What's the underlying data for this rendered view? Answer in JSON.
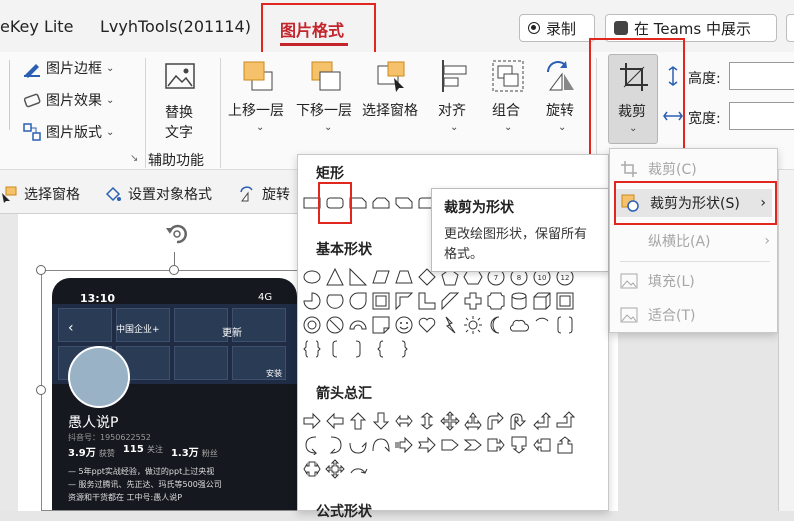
{
  "tabs": [
    {
      "label": "eKey Lite"
    },
    {
      "label": "LvyhTools(201114)"
    },
    {
      "label": "图片格式"
    }
  ],
  "header_buttons": {
    "record": "录制",
    "teams": "在 Teams 中展示"
  },
  "ribbon": {
    "picture_border": "图片边框",
    "picture_effects": "图片效果",
    "picture_layout": "图片版式",
    "alt_text_line1": "替换",
    "alt_text_line2": "文字",
    "accessibility_group": "辅助功能",
    "bring_forward": "上移一层",
    "send_backward": "下移一层",
    "selection_pane": "选择窗格",
    "align": "对齐",
    "group": "组合",
    "rotate": "旋转",
    "crop": "裁剪",
    "height": "高度:",
    "width": "宽度:"
  },
  "toolbar2": {
    "selection_pane": "选择窗格",
    "format_object": "设置对象格式",
    "rotate": "旋转"
  },
  "shapes_menu": {
    "rectangles": "矩形",
    "basic_shapes": "基本形状",
    "block_arrows": "箭头总汇",
    "equation_shapes": "公式形状"
  },
  "tooltip": {
    "title": "裁剪为形状",
    "description": "更改绘图形状，保留所有格式。"
  },
  "crop_menu": {
    "crop": "裁剪(C)",
    "crop_to_shape": "裁剪为形状(S)",
    "aspect_ratio": "纵横比(A)",
    "fill": "填充(L)",
    "fit": "适合(T)"
  },
  "phone": {
    "time": "13:10",
    "signal": "4G",
    "update_label": "更新",
    "profile_name": "愚人说P",
    "douyin_id": "抖音号：1950622552",
    "stats": [
      {
        "value": "3.9万",
        "label": "获赞"
      },
      {
        "value": "115",
        "label": "关注"
      },
      {
        "value": "1.3万",
        "label": "粉丝"
      }
    ],
    "bio_line1": "— 5年ppt实战经验，做过的ppt上过央视",
    "bio_line2": "— 服务过腾讯、先正达、玛氏等500强公司",
    "bio_line3": "资源和干货都在 工中号:愚人说P",
    "banner_caption": "中国企业+",
    "install_label": "安装"
  },
  "colors": {
    "accent_red": "#c4242b",
    "highlight_box": "#e0261e"
  }
}
